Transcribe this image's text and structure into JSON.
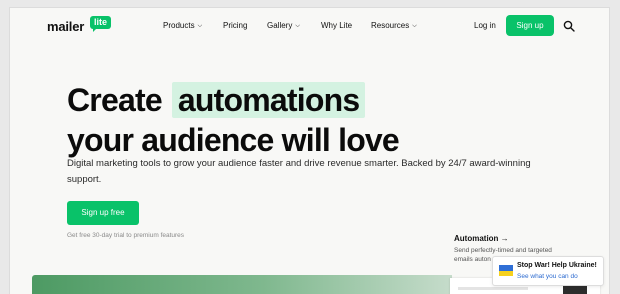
{
  "header": {
    "logo_text": "mailer",
    "logo_badge": "lite",
    "nav": [
      {
        "label": "Products",
        "dropdown": true
      },
      {
        "label": "Pricing",
        "dropdown": false
      },
      {
        "label": "Gallery",
        "dropdown": true
      },
      {
        "label": "Why Lite",
        "dropdown": false
      },
      {
        "label": "Resources",
        "dropdown": true
      }
    ],
    "login_label": "Log in",
    "signup_label": "Sign up",
    "search_icon": "search-icon"
  },
  "hero": {
    "headline_pre": "Create",
    "headline_highlight": "automations",
    "headline_line2": "your audience will love",
    "subtext": "Digital marketing tools to grow your audience faster and drive revenue smarter. Backed by 24/7 award-winning support.",
    "cta_label": "Sign up free",
    "trial_note": "Get free 30-day trial to premium features"
  },
  "feature": {
    "title": "Automation →",
    "desc": "Send perfectly-timed and targeted emails auton"
  },
  "ukraine_banner": {
    "title": "Stop War! Help Ukraine!",
    "link": "See what you can do"
  },
  "colors": {
    "brand_green": "#09c269",
    "highlight_bg": "#d4f2e1",
    "flag_blue": "#2f6fd6",
    "flag_yellow": "#f6d11e"
  }
}
